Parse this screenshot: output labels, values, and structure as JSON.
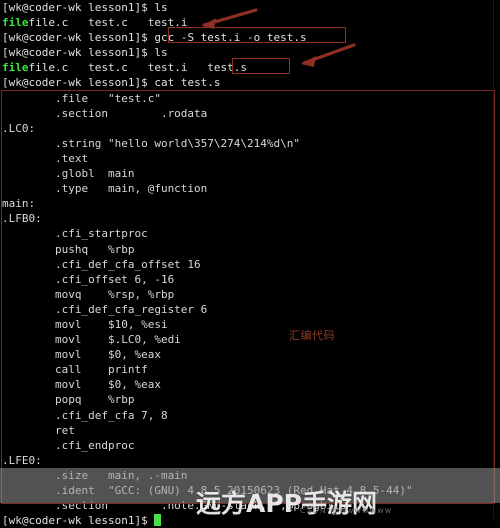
{
  "terminal": {
    "user_host": "[wk@coder-wk lesson1]$",
    "colors": {
      "background": "#000000",
      "foreground": "#d8d8d8",
      "directory": "#3ae33a",
      "annotation_red": "#8f2e22",
      "cursor": "#4ae04a"
    },
    "lines": [
      {
        "type": "prompt",
        "prompt": "[wk@coder-wk lesson1]$ ",
        "command": "ls"
      },
      {
        "type": "lsout",
        "dir": "file",
        "files": "file.c   test.c   test.i"
      },
      {
        "type": "prompt",
        "prompt": "[wk@coder-wk lesson1]$ ",
        "command": "gcc -S test.i -o test.s"
      },
      {
        "type": "prompt",
        "prompt": "[wk@coder-wk lesson1]$ ",
        "command": "ls"
      },
      {
        "type": "lsout",
        "dir": "file",
        "files": "file.c   test.c   test.i   test.s"
      },
      {
        "type": "prompt",
        "prompt": "[wk@coder-wk lesson1]$ ",
        "command": "cat test.s"
      }
    ],
    "asm": [
      "        .file   \"test.c\"",
      "        .section        .rodata",
      ".LC0:",
      "        .string \"hello world\\357\\274\\214%d\\n\"",
      "        .text",
      "        .globl  main",
      "        .type   main, @function",
      "main:",
      ".LFB0:",
      "        .cfi_startproc",
      "        pushq   %rbp",
      "        .cfi_def_cfa_offset 16",
      "        .cfi_offset 6, -16",
      "        movq    %rsp, %rbp",
      "        .cfi_def_cfa_register 6",
      "        movl    $10, %esi",
      "        movl    $.LC0, %edi",
      "        movl    $0, %eax",
      "        call    printf",
      "        movl    $0, %eax",
      "        popq    %rbp",
      "        .cfi_def_cfa 7, 8",
      "        ret",
      "        .cfi_endproc",
      ".LFE0:",
      "        .size   main, .-main",
      "        .ident  \"GCC: (GNU) 4.8.5 20150623 (Red Hat 4.8.5-44)\"",
      "        .section        .note.GNU-stack,\"\",@progbits"
    ],
    "final_prompt": "[wk@coder-wk lesson1]$ "
  },
  "annotations": {
    "assembly_label": "汇编代码",
    "box_command_label": "gcc -S test.i -o test.s",
    "box_file_label": "test.s"
  },
  "watermark": {
    "main": "远方APP手游网",
    "sub": "CSDN @wwwwwww"
  }
}
